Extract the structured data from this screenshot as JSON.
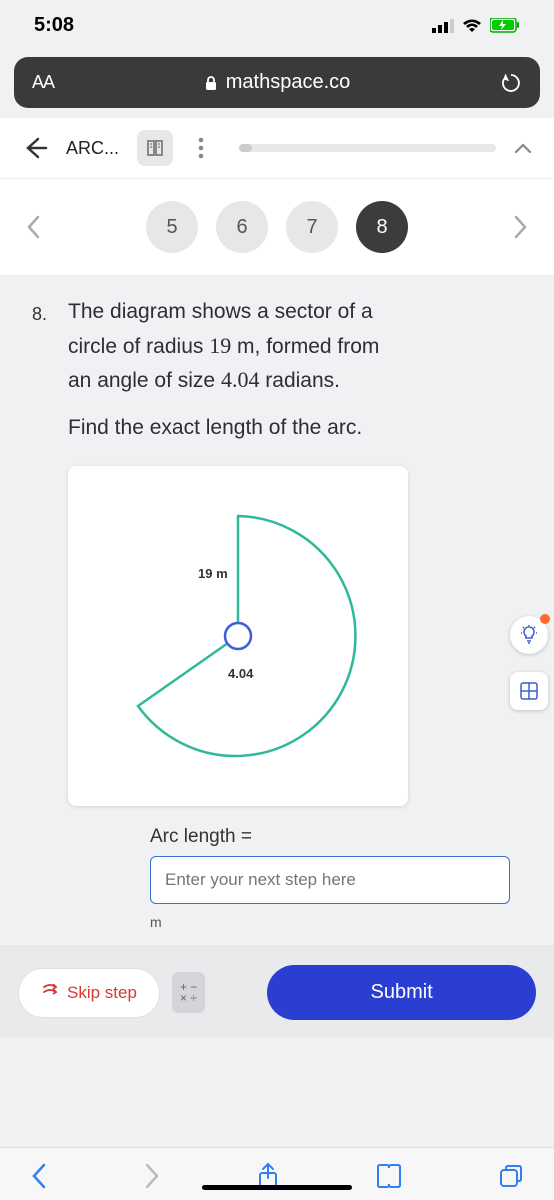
{
  "status": {
    "time": "5:08"
  },
  "url_bar": {
    "font_controls": "AA",
    "domain": "mathspace.co"
  },
  "top": {
    "title": "ARC..."
  },
  "pager": {
    "items": [
      "5",
      "6",
      "7",
      "8"
    ],
    "active_index": 3
  },
  "question": {
    "number": "8.",
    "line1_a": "The diagram shows a sector of a",
    "line2_a": "circle of radius ",
    "radius": "19",
    "line2_b": " m, formed from",
    "line3_a": "an angle of size ",
    "angle": "4.04",
    "line3_b": " radians.",
    "line4": "Find the exact length of the arc."
  },
  "diagram": {
    "radius_label": "19 m",
    "angle_label": "4.04"
  },
  "answer": {
    "label": "Arc length =",
    "placeholder": "Enter your next step here",
    "unit": "m"
  },
  "actions": {
    "skip": "Skip step",
    "submit": "Submit"
  }
}
